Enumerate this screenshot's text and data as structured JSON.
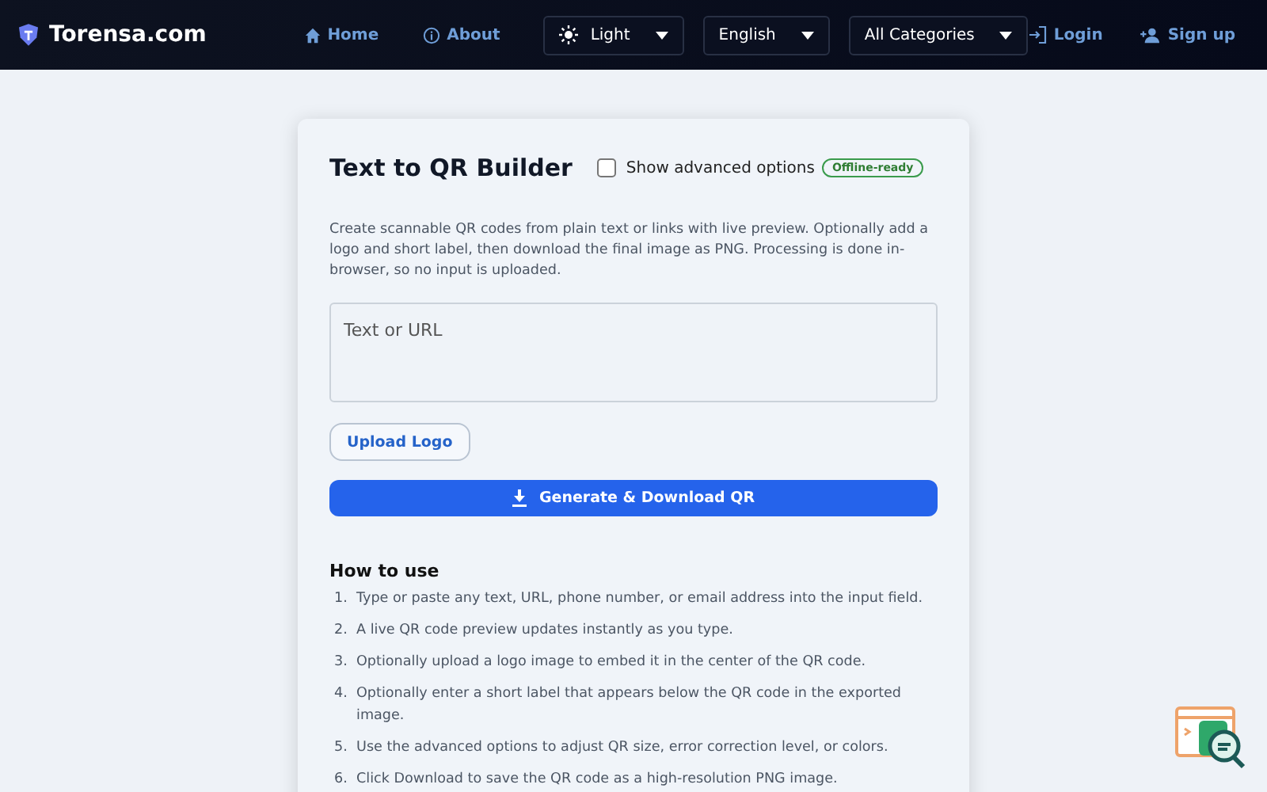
{
  "header": {
    "brand": "Torensa.com",
    "nav": [
      {
        "kind": "home",
        "label": "Home"
      },
      {
        "kind": "info",
        "label": "About"
      }
    ],
    "selects": [
      {
        "kind": "theme",
        "label": "Light"
      },
      {
        "kind": "plain",
        "label": "English"
      },
      {
        "kind": "plain",
        "label": "All Categories"
      }
    ],
    "auth": [
      {
        "kind": "login",
        "label": "Login"
      },
      {
        "kind": "signup",
        "label": "Sign up"
      }
    ]
  },
  "card": {
    "title": "Text to QR Builder",
    "advanced": {
      "label": "Show advanced options",
      "checked": false
    },
    "badge": "Offline-ready",
    "description": "Create scannable QR codes from plain text or links with live preview. Optionally add a logo and short label, then download the final image as PNG. Processing is done in-browser, so no input is uploaded.",
    "input": {
      "placeholder": "Text or URL"
    },
    "upload_button": "Upload Logo",
    "generate_button": "Generate & Download QR",
    "howto": {
      "title": "How to use",
      "steps": [
        {
          "number": "1.",
          "text": "Type or paste any text, URL, phone number, or email address into the input field."
        },
        {
          "number": "2.",
          "text": "A live QR code preview updates instantly as you type."
        },
        {
          "number": "3.",
          "text": "Optionally upload a logo image to embed it in the center of the QR code."
        },
        {
          "number": "4.",
          "text": "Optionally enter a short label that appears below the QR code in the exported image."
        },
        {
          "number": "5.",
          "text": "Use the advanced options to adjust QR size, error correction level, or colors."
        },
        {
          "number": "6.",
          "text": "Click Download to save the QR code as a high-resolution PNG image."
        }
      ]
    }
  }
}
